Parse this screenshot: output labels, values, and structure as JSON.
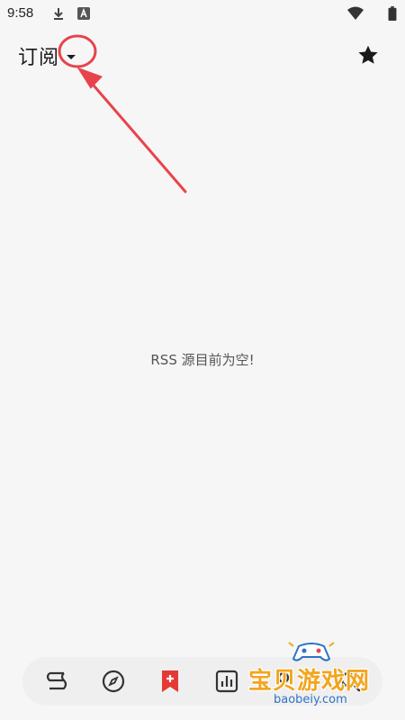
{
  "status_bar": {
    "time": "9:58",
    "icons": [
      "download-icon",
      "font-a-icon",
      "wifi-icon",
      "battery-icon"
    ]
  },
  "app_bar": {
    "title": "订阅",
    "dropdown_icon": "caret-down-icon",
    "favorite_icon": "star-icon"
  },
  "content": {
    "empty_message": "RSS 源目前为空!"
  },
  "annotation": {
    "color": "#e8434b"
  },
  "bottom_nav": {
    "items": [
      {
        "icon": "bookshelf-icon",
        "active": false
      },
      {
        "icon": "compass-icon",
        "active": false
      },
      {
        "icon": "rss-bookmark-icon",
        "active": true
      },
      {
        "icon": "chart-icon",
        "active": false
      },
      {
        "icon": "profile-icon",
        "active": false
      },
      {
        "icon": "search-icon",
        "active": false
      }
    ],
    "active_color": "#e53935"
  },
  "watermark": {
    "title": "宝贝游戏网",
    "url": "baobeiy.com"
  }
}
